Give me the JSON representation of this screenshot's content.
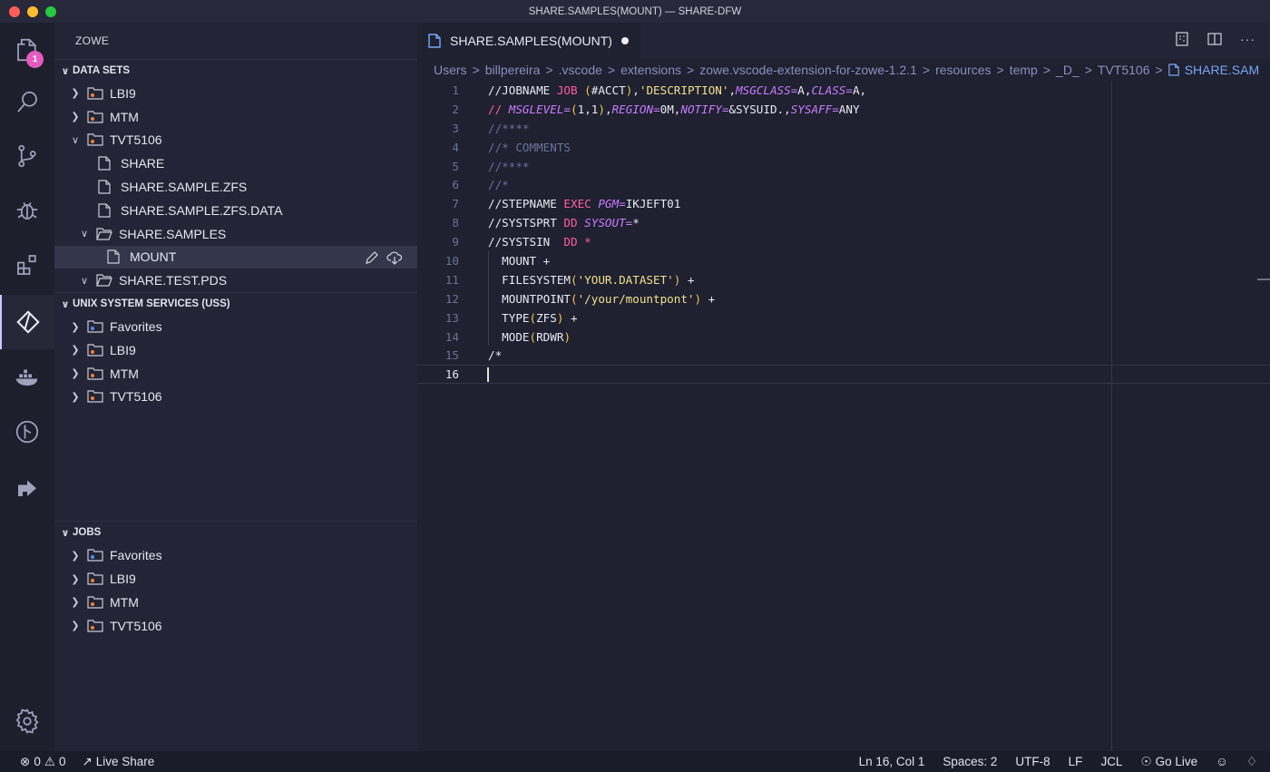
{
  "window": {
    "title": "SHARE.SAMPLES(MOUNT) — SHARE-DFW"
  },
  "colors": {
    "accent": "#d0c5ff",
    "badge": "#e55ac0",
    "folder_dot": "#f0803c",
    "favorite_dot": "#5b8cf0"
  },
  "activity_bar": {
    "items": [
      "explorer-icon",
      "search-icon",
      "source-control-icon",
      "debug-icon",
      "extensions-icon",
      "zowe-icon",
      "docker-icon",
      "git-graph-icon",
      "live-share-icon"
    ],
    "badge": "1",
    "settings": "gear-icon"
  },
  "sidebar": {
    "title": "ZOWE",
    "datasets": {
      "header": "DATA SETS",
      "items": [
        {
          "label": "LBI9"
        },
        {
          "label": "MTM"
        },
        {
          "label": "TVT5106"
        },
        {
          "label": "SHARE"
        },
        {
          "label": "SHARE.SAMPLE.ZFS"
        },
        {
          "label": "SHARE.SAMPLE.ZFS.DATA"
        },
        {
          "label": "SHARE.SAMPLES"
        },
        {
          "label": "MOUNT"
        },
        {
          "label": "SHARE.TEST.PDS"
        }
      ]
    },
    "uss": {
      "header": "UNIX SYSTEM SERVICES (USS)",
      "items": [
        {
          "label": "Favorites"
        },
        {
          "label": "LBI9"
        },
        {
          "label": "MTM"
        },
        {
          "label": "TVT5106"
        }
      ]
    },
    "jobs": {
      "header": "JOBS",
      "items": [
        {
          "label": "Favorites"
        },
        {
          "label": "LBI9"
        },
        {
          "label": "MTM"
        },
        {
          "label": "TVT5106"
        }
      ]
    }
  },
  "editor": {
    "tab_label": "SHARE.SAMPLES(MOUNT)",
    "breadcrumb": [
      "Users",
      "billpereira",
      ".vscode",
      "extensions",
      "zowe.vscode-extension-for-zowe-1.2.1",
      "resources",
      "temp",
      "_D_",
      "TVT5106",
      "SHARE.SAM"
    ],
    "line_numbers": [
      "1",
      "2",
      "3",
      "4",
      "5",
      "6",
      "7",
      "8",
      "9",
      "10",
      "11",
      "12",
      "13",
      "14",
      "15",
      "16"
    ]
  },
  "status": {
    "errors": "0",
    "warnings": "0",
    "live_share": "Live Share",
    "position": "Ln 16, Col 1",
    "spaces": "Spaces: 2",
    "encoding": "UTF-8",
    "eol": "LF",
    "language": "JCL",
    "go_live": "Go Live"
  }
}
